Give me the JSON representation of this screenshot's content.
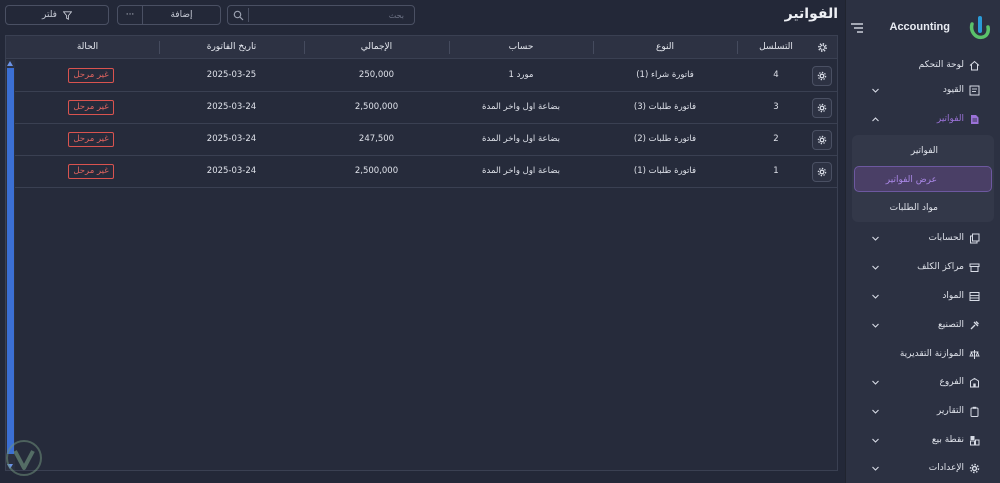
{
  "app": {
    "brand": "Accounting",
    "page_title": "الفواتير"
  },
  "colors": {
    "accent": "#9b72d8",
    "badge": "#d9534f",
    "scroll": "#3b6fd4",
    "logo_primary": "#2a9bd8",
    "logo_secondary": "#5ac26a"
  },
  "toolbar": {
    "search_placeholder": "بحث",
    "add_label": "إضافة",
    "more_label": "···",
    "filter_label": "فلتر"
  },
  "sidebar": {
    "items": [
      {
        "label": "لوحة التحكم",
        "icon": "home-icon"
      },
      {
        "label": "القيود",
        "icon": "journal-icon",
        "expandable": true
      },
      {
        "label": "الفواتير",
        "icon": "invoice-icon",
        "expandable": true,
        "active": true
      },
      {
        "label": "الحسابات",
        "icon": "accounts-icon",
        "expandable": true
      },
      {
        "label": "مراكز الكلف",
        "icon": "cost-center-icon",
        "expandable": true
      },
      {
        "label": "المواد",
        "icon": "materials-icon",
        "expandable": true
      },
      {
        "label": "التصنيع",
        "icon": "manufacturing-icon",
        "expandable": true
      },
      {
        "label": "الموازنة التقديرية",
        "icon": "budget-icon"
      },
      {
        "label": "الفروع",
        "icon": "branches-icon",
        "expandable": true
      },
      {
        "label": "التقارير",
        "icon": "reports-icon",
        "expandable": true
      },
      {
        "label": "نقطة بيع",
        "icon": "pos-icon",
        "expandable": true
      },
      {
        "label": "الإعدادات",
        "icon": "settings-icon",
        "expandable": true
      }
    ],
    "submenu": [
      {
        "label": "الفواتير"
      },
      {
        "label": "عرض الفواتير",
        "active": true
      },
      {
        "label": "مواد الطلبات"
      }
    ]
  },
  "table": {
    "columns": {
      "serial": "التسلسل",
      "type": "النوع",
      "account": "حساب",
      "total": "الإجمالي",
      "date": "تاريخ الفاتورة",
      "status": "الحالة"
    },
    "rows": [
      {
        "serial": "4",
        "type": "فاتورة شراء (1)",
        "account": "مورد 1",
        "total": "250,000",
        "date": "2025-03-25",
        "status": "غير مرحل"
      },
      {
        "serial": "3",
        "type": "فاتورة طلبات (3)",
        "account": "بضاعة اول واخر المدة",
        "total": "2,500,000",
        "date": "2025-03-24",
        "status": "غير مرحل"
      },
      {
        "serial": "2",
        "type": "فاتورة طلبات (2)",
        "account": "بضاعة اول واخر المدة",
        "total": "247,500",
        "date": "2025-03-24",
        "status": "غير مرحل"
      },
      {
        "serial": "1",
        "type": "فاتورة طلبات (1)",
        "account": "بضاعة اول واخر المدة",
        "total": "2,500,000",
        "date": "2025-03-24",
        "status": "غير مرحل"
      }
    ]
  }
}
